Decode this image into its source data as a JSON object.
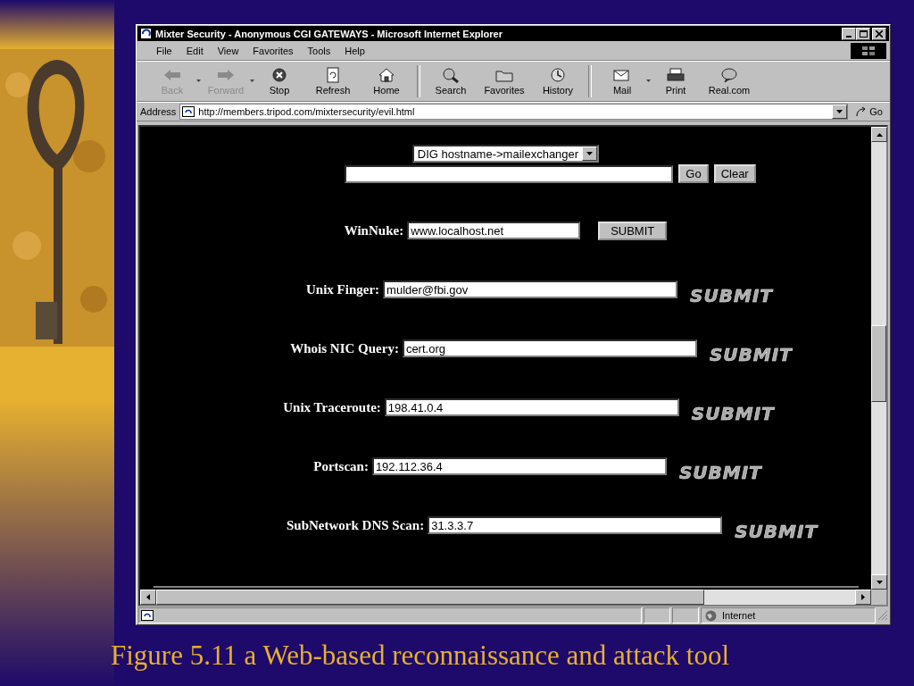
{
  "window": {
    "title": "Mixter Security - Anonymous CGI GATEWAYS - Microsoft Internet Explorer"
  },
  "menu": [
    "File",
    "Edit",
    "View",
    "Favorites",
    "Tools",
    "Help"
  ],
  "toolbar": [
    {
      "label": "Back",
      "disabled": true,
      "dropdown": true
    },
    {
      "label": "Forward",
      "disabled": true,
      "dropdown": true
    },
    {
      "label": "Stop",
      "disabled": false,
      "dropdown": false
    },
    {
      "label": "Refresh",
      "disabled": false,
      "dropdown": false
    },
    {
      "label": "Home",
      "disabled": false,
      "dropdown": false
    },
    {
      "label": "Search",
      "disabled": false,
      "dropdown": false
    },
    {
      "label": "Favorites",
      "disabled": false,
      "dropdown": false
    },
    {
      "label": "History",
      "disabled": false,
      "dropdown": false
    },
    {
      "label": "Mail",
      "disabled": false,
      "dropdown": true
    },
    {
      "label": "Print",
      "disabled": false,
      "dropdown": false
    },
    {
      "label": "Real.com",
      "disabled": false,
      "dropdown": false
    }
  ],
  "address": {
    "label": "Address",
    "url": "http://members.tripod.com/mixtersecurity/evil.html",
    "go": "Go"
  },
  "dig": {
    "select": "DIG hostname->mailexchanger",
    "go": "Go",
    "clear": "Clear"
  },
  "forms": [
    {
      "label": "WinNuke:",
      "value": "www.localhost.net",
      "kind": "button",
      "submit": "SUBMIT"
    },
    {
      "label": "Unix Finger:",
      "value": "mulder@fbi.gov",
      "submit": "SUBMIT"
    },
    {
      "label": "Whois NIC Query:",
      "value": "cert.org",
      "submit": "SUBMIT"
    },
    {
      "label": "Unix Traceroute:",
      "value": "198.41.0.4",
      "submit": "SUBMIT"
    },
    {
      "label": "Portscan:",
      "value": "192.112.36.4",
      "submit": "SUBMIT"
    },
    {
      "label": "SubNetwork DNS Scan:",
      "value": "31.3.3.7",
      "submit": "SUBMIT"
    }
  ],
  "status_bar": {
    "zone": "Internet"
  },
  "caption": "Figure 5.11 a Web-based reconnaissance and attack tool"
}
